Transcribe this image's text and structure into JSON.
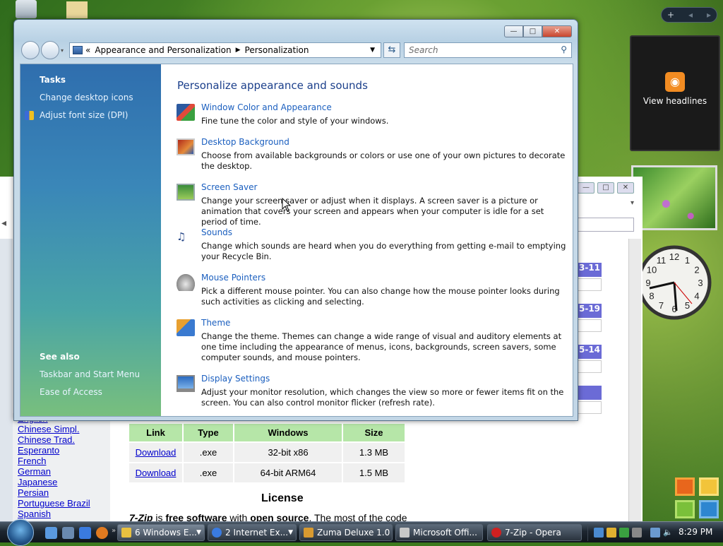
{
  "window": {
    "breadcrumb": [
      "Appearance and Personalization",
      "Personalization"
    ],
    "breadcrumb_prefix": "«",
    "search_placeholder": "Search",
    "title_buttons": {
      "minimize": "—",
      "maximize": "□",
      "close": "✕"
    }
  },
  "sidebar": {
    "tasks_header": "Tasks",
    "tasks": [
      "Change desktop icons",
      "Adjust font size (DPI)"
    ],
    "see_also_header": "See also",
    "see_also": [
      "Taskbar and Start Menu",
      "Ease of Access"
    ]
  },
  "main": {
    "title": "Personalize appearance and sounds",
    "items": [
      {
        "title": "Window Color and Appearance",
        "desc": "Fine tune the color and style of your windows.",
        "icon": "window-color-icon"
      },
      {
        "title": "Desktop Background",
        "desc": "Choose from available backgrounds or colors or use one of your own pictures to decorate the desktop.",
        "icon": "desktop-background-icon"
      },
      {
        "title": "Screen Saver",
        "desc": "Change your screen saver or adjust when it displays. A screen saver is a picture or animation that covers your screen and appears when your computer is idle for a set period of time.",
        "icon": "screen-saver-icon"
      },
      {
        "title": "Sounds",
        "desc": "Change which sounds are heard when you do everything from getting e-mail to emptying your Recycle Bin.",
        "icon": "sounds-icon"
      },
      {
        "title": "Mouse Pointers",
        "desc": "Pick a different mouse pointer. You can also change how the mouse pointer looks during such activities as clicking and selecting.",
        "icon": "mouse-pointer-icon"
      },
      {
        "title": "Theme",
        "desc": "Change the theme. Themes can change a wide range of visual and auditory elements at one time including the appearance of menus, icons, backgrounds, screen savers, some computer sounds, and mouse pointers.",
        "icon": "theme-icon"
      },
      {
        "title": "Display Settings",
        "desc": "Adjust your monitor resolution, which changes the view so more or fewer items fit on the screen. You can also control monitor flicker (refresh rate).",
        "icon": "display-settings-icon"
      }
    ]
  },
  "browser": {
    "languages": [
      "English",
      "Chinese Simpl.",
      "Chinese Trad.",
      "Esperanto",
      "French",
      "German",
      "Japanese",
      "Persian",
      "Portuguese Brazil",
      "Spanish"
    ],
    "partial_dates": [
      "3-11",
      "5-19",
      "5-14"
    ],
    "table": {
      "headers": [
        "Link",
        "Type",
        "Windows",
        "Size"
      ],
      "rows": [
        [
          "Download",
          ".exe",
          "32-bit x86",
          "1.3 MB"
        ],
        [
          "Download",
          ".exe",
          "64-bit ARM64",
          "1.5 MB"
        ]
      ]
    },
    "license_title": "License",
    "license_text": {
      "a": "7-Zip",
      "b": " is ",
      "c": "free software",
      "d": " with ",
      "e": "open source",
      "f": ". The most of the code"
    }
  },
  "gadgets": {
    "feed_label": "View headlines",
    "clock_numbers": [
      "12",
      "1",
      "2",
      "3",
      "4",
      "5",
      "6",
      "7",
      "8",
      "9",
      "10",
      "11"
    ]
  },
  "taskbar": {
    "tasks": [
      {
        "label": "6 Windows E...",
        "icon_color": "#e8c040"
      },
      {
        "label": "2 Internet Ex...",
        "icon_color": "#3a7be0"
      },
      {
        "label": "Zuma Deluxe 1.0",
        "icon_color": "#d89a30"
      },
      {
        "label": "Microsoft Offi...",
        "icon_color": "#c8c8c8"
      },
      {
        "label": "7-Zip - Opera",
        "icon_color": "#d02020"
      }
    ],
    "clock": "8:29 PM"
  },
  "colors": {
    "link": "#1b5fbf",
    "title": "#1b3f8b",
    "close_red": "#c9452d"
  }
}
